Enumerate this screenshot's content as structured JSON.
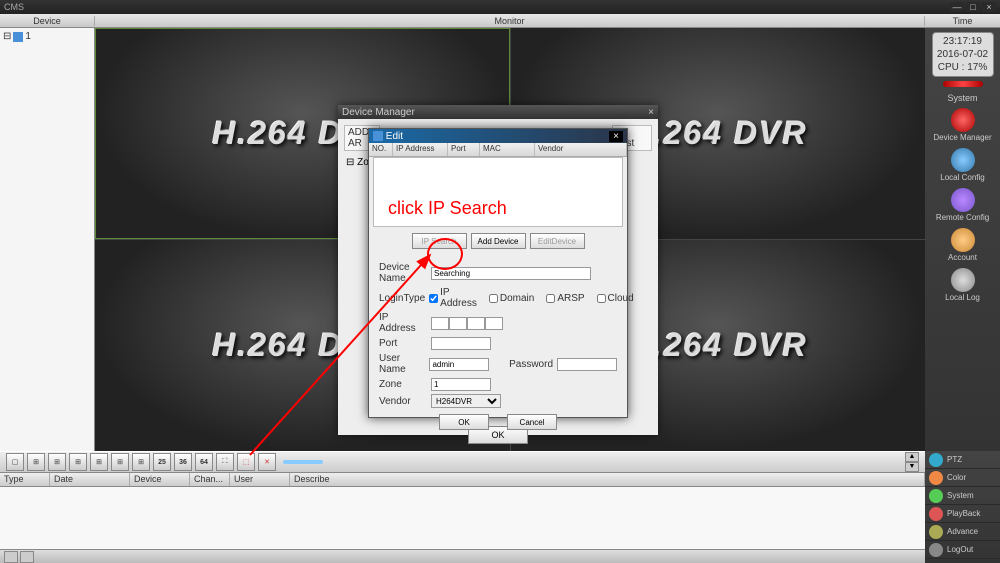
{
  "app_title": "CMS",
  "header": {
    "device": "Device",
    "monitor": "Monitor",
    "time": "Time"
  },
  "tree": {
    "root": "1"
  },
  "watermark": "H.264 DVR",
  "time_box": {
    "time": "23:17:19",
    "date": "2016-07-02",
    "cpu": "CPU : 17%"
  },
  "system": {
    "label": "System",
    "items": [
      {
        "label": "Device Manager",
        "color": "#d33"
      },
      {
        "label": "Local Config",
        "color": "#4a90d9"
      },
      {
        "label": "Remote Config",
        "color": "#7a50c0"
      },
      {
        "label": "Account",
        "color": "#d9a23a"
      },
      {
        "label": "Local Log",
        "color": "#888"
      }
    ]
  },
  "grid_nums": [
    "25",
    "36",
    "64"
  ],
  "log_cols": {
    "type": "Type",
    "date": "Date",
    "device": "Device",
    "chan": "Chan...",
    "user": "User",
    "describe": "Describe"
  },
  "br_buttons": [
    {
      "label": "PTZ",
      "color": "#3ac"
    },
    {
      "label": "Color",
      "color": "#e84"
    },
    {
      "label": "System",
      "color": "#5c5"
    },
    {
      "label": "PlayBack",
      "color": "#d55"
    },
    {
      "label": "Advance",
      "color": "#aa5"
    },
    {
      "label": "LogOut",
      "color": "#888"
    }
  ],
  "device_manager": {
    "title": "Device Manager",
    "add_area": "ADD AR",
    "zone": "Zone",
    "ion_test": "on Test",
    "ok": "OK"
  },
  "edit_dialog": {
    "title": "Edit",
    "cols": {
      "no": "NO.",
      "ip": "IP Address",
      "port": "Port",
      "mac": "MAC",
      "vendor": "Vendor"
    },
    "buttons": {
      "ip_search": "IP Search",
      "add_device": "Add Device",
      "edit_device": "EditDevice"
    },
    "fields": {
      "device_name_label": "Device Name",
      "device_name_value": "Searching",
      "login_type_label": "LoginType",
      "ip_address_opt": "IP Address",
      "domain_opt": "Domain",
      "arsp_opt": "ARSP",
      "cloud_opt": "Cloud",
      "ip_address_label": "IP Address",
      "port_label": "Port",
      "port_value": "",
      "username_label": "User Name",
      "username_value": "admin",
      "password_label": "Password",
      "password_value": "",
      "zone_label": "Zone",
      "zone_value": "1",
      "vendor_label": "Vendor",
      "vendor_value": "H264DVR"
    },
    "ok": "OK",
    "cancel": "Cancel"
  },
  "annotation_text": "click IP Search"
}
